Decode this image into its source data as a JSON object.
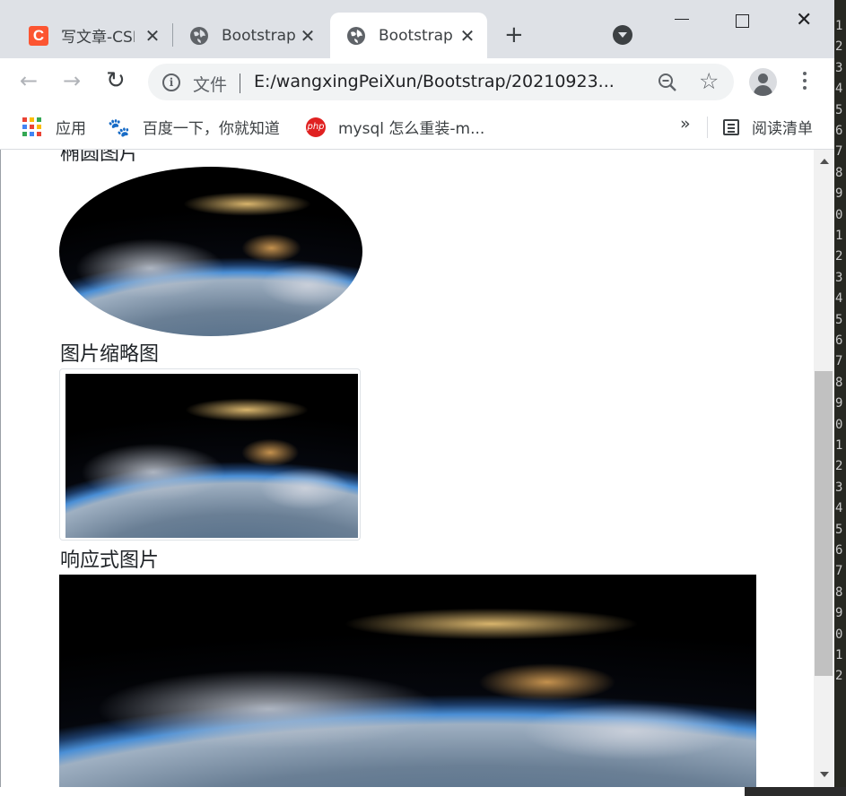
{
  "tabs": [
    {
      "title": "写文章-CSDN博客",
      "favicon": "csdn-icon",
      "favicon_letter": "C",
      "close": "✕"
    },
    {
      "title": "Bootstrap",
      "favicon": "globe-icon",
      "close": "✕"
    },
    {
      "title": "Bootstrap",
      "favicon": "globe-icon",
      "close": "✕",
      "active": true
    }
  ],
  "tabstrip": {
    "new_tab": "+",
    "close_window": "✕"
  },
  "toolbar": {
    "back": "←",
    "forward": "→",
    "reload": "↻",
    "info_glyph": "i",
    "file_label": "文件",
    "url": "E:/wangxingPeiXun/Bootstrap/20210923...",
    "star": "☆"
  },
  "bookmarks": {
    "items": [
      {
        "label": "应用",
        "icon": "apps-grid-icon"
      },
      {
        "label": "百度一下，你就知道",
        "icon": "baidu-icon"
      },
      {
        "label": "mysql 怎么重装-m...",
        "icon": "php-icon",
        "icon_text": "php"
      }
    ],
    "more": "»",
    "reading_list": "阅读清单"
  },
  "page": {
    "ellipse_heading": "椭圆图片",
    "thumbnail_heading": "图片缩略图",
    "responsive_heading": "响应式图片"
  },
  "editor_line_digits": [
    "1",
    "2",
    "3",
    "4",
    "5",
    "6",
    "7",
    "8",
    "9",
    "0",
    "1",
    "2",
    "3",
    "4",
    "5",
    "6",
    "7",
    "8",
    "9",
    "0",
    "1",
    "2",
    "3",
    "4",
    "5",
    "6",
    "7",
    "8",
    "9",
    "0",
    "1",
    "2"
  ],
  "colors": {
    "tabstrip_bg": "#dee1e6",
    "omnibox_bg": "#f1f3f4",
    "csdn_red": "#fc5531",
    "text": "#212529"
  }
}
